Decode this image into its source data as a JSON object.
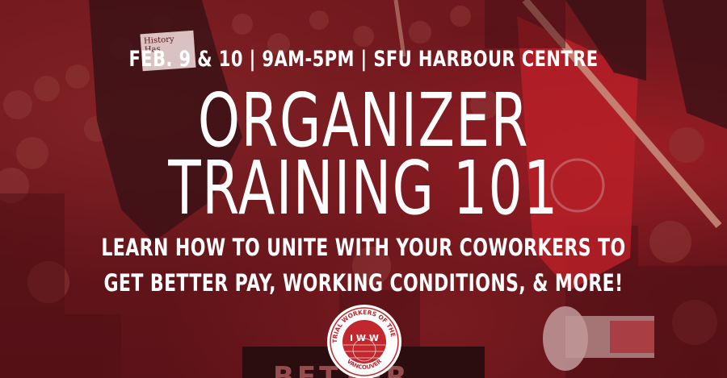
{
  "event": {
    "details": "FEB. 9 & 10 | 9AM-5PM | SFU HARBOUR CENTRE"
  },
  "title": {
    "line1": "ORGANIZER",
    "line2": "TRAINING 101"
  },
  "subtitle": {
    "line1": "LEARN HOW TO UNITE WITH YOUR COWORKERS TO",
    "line2": "GET BETTER PAY, WORKING CONDITIONS, & MORE!"
  },
  "logo": {
    "ring_text_top": "INDUSTRIAL WORKERS OF THE WORLD",
    "center_text": "I W W",
    "ring_text_bottom": "VANCOUVER"
  },
  "background": {
    "sign_text": "History Has",
    "banner_text": "BETTER"
  },
  "colors": {
    "overlay": "#7a1c22",
    "flag_red": "#d9262d",
    "flag_black": "#1a1012",
    "text": "#ffffff"
  }
}
